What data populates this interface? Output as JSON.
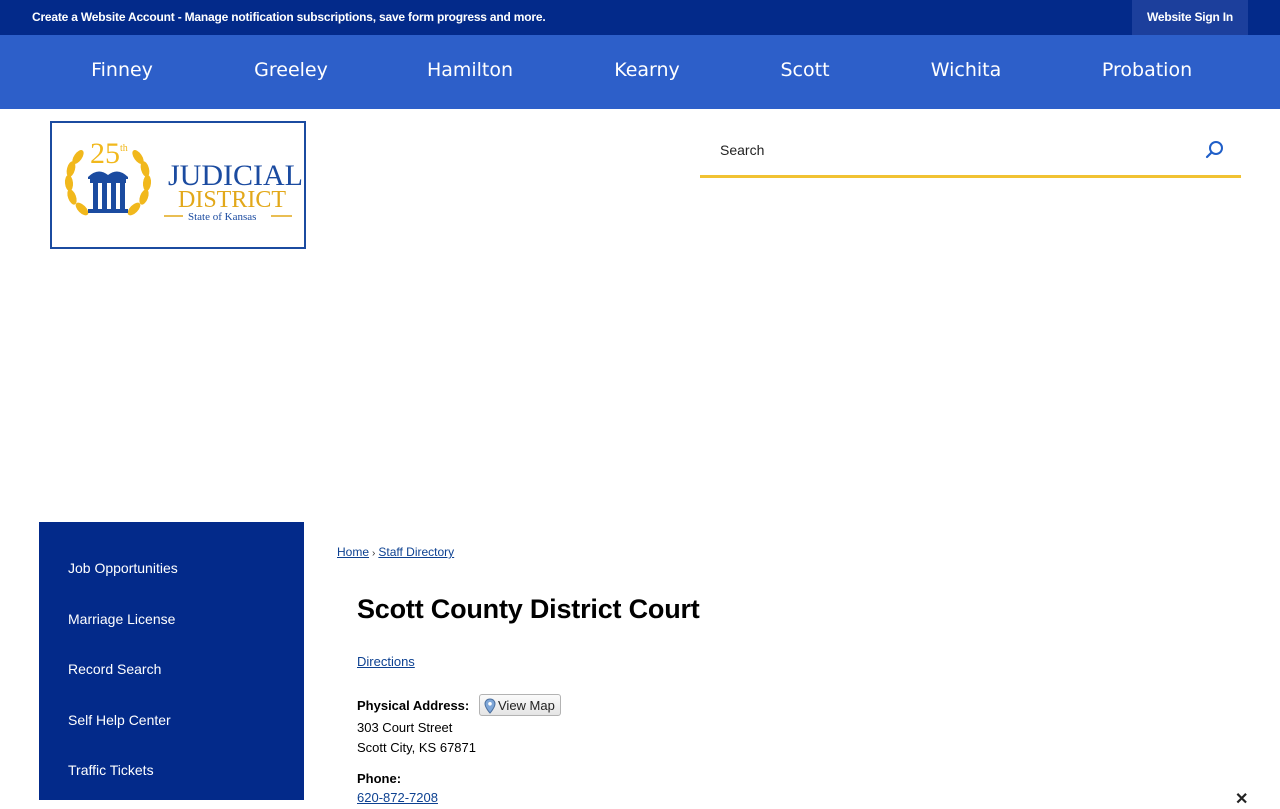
{
  "topbar": {
    "promo_text": "Create a Website Account - Manage notification subscriptions, save form progress and more.",
    "signin_label": "Website Sign In"
  },
  "nav": {
    "items": [
      "Finney",
      "Greeley",
      "Hamilton",
      "Kearny",
      "Scott",
      "Wichita",
      "Probation"
    ]
  },
  "logo": {
    "number": "25",
    "superscript": "th",
    "line1": "JUDICIAL",
    "line2": "DISTRICT",
    "line3": "State of Kansas"
  },
  "search": {
    "placeholder": "Search",
    "icon": "search-icon"
  },
  "sidebar": {
    "items": [
      "Job Opportunities",
      "Marriage License",
      "Record Search",
      "Self Help Center",
      "Traffic Tickets"
    ]
  },
  "breadcrumb": {
    "home": "Home",
    "separator": "›",
    "current": "Staff Directory"
  },
  "main": {
    "title": "Scott County District Court",
    "directions_link": "Directions",
    "physical_address_label": "Physical Address:",
    "view_map_label": "View Map",
    "address_line1": "303 Court Street",
    "address_line2": "Scott City, KS 67871",
    "phone_label": "Phone:",
    "phone_number": "620-872-7208"
  },
  "close_glyph": "✕",
  "colors": {
    "topbar_bg": "#032a8a",
    "nav_bg": "#2d5fc9",
    "accent_gold": "#f1c232",
    "link_blue": "#0d4191"
  }
}
